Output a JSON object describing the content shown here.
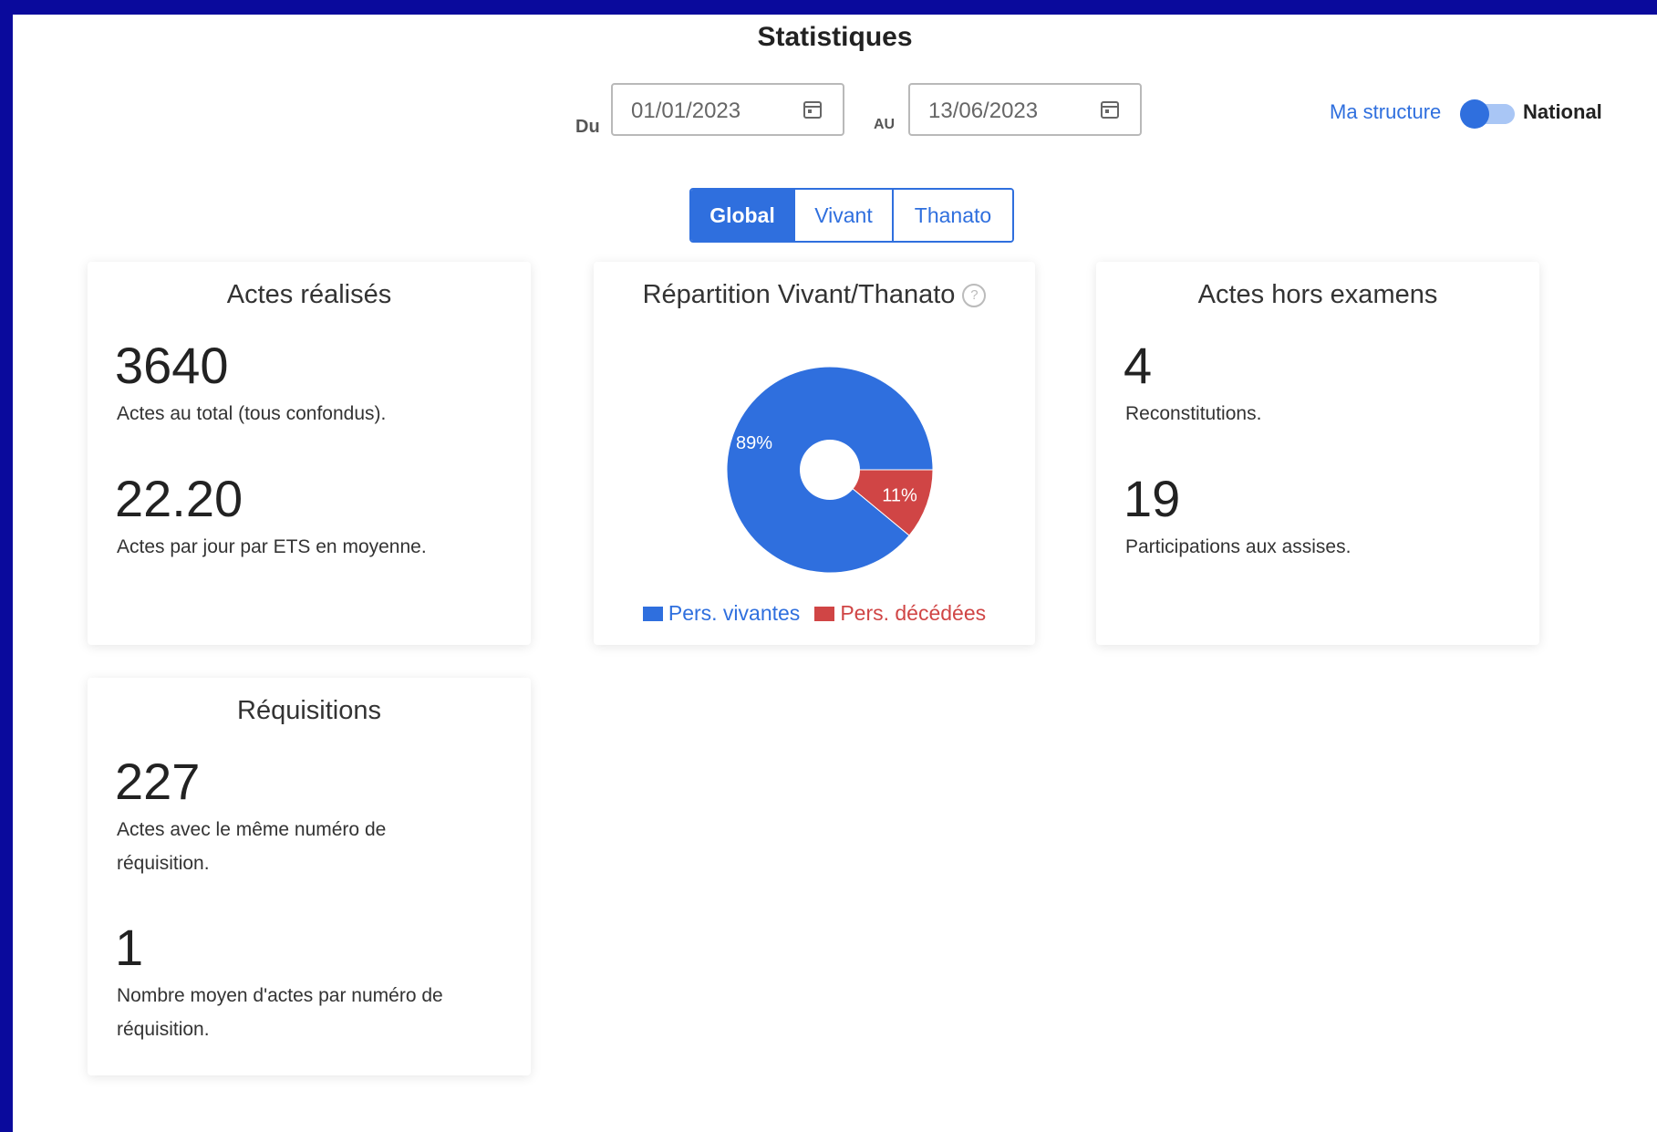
{
  "page_title": "Statistiques",
  "filters": {
    "from_label": "Du",
    "from_value": "01/01/2023",
    "to_label": "AU",
    "to_value": "13/06/2023",
    "scope_left": "Ma structure",
    "scope_right": "National",
    "scope_selected": "Ma structure"
  },
  "tabs": [
    {
      "label": "Global",
      "active": true
    },
    {
      "label": "Vivant",
      "active": false
    },
    {
      "label": "Thanato",
      "active": false
    }
  ],
  "cards": {
    "actes": {
      "title": "Actes réalisés",
      "stat1_value": "3640",
      "stat1_desc": "Actes au total (tous confondus).",
      "stat2_value": "22.20",
      "stat2_desc": "Actes par jour par ETS en moyenne."
    },
    "repartition": {
      "title": "Répartition Vivant/Thanato",
      "help_icon": "question-circle-icon"
    },
    "hors_examens": {
      "title": "Actes hors examens",
      "stat1_value": "4",
      "stat1_desc": "Reconstitutions.",
      "stat2_value": "19",
      "stat2_desc": "Participations aux assises."
    },
    "requisitions": {
      "title": "Réquisitions",
      "stat1_value": "227",
      "stat1_desc": "Actes avec le même numéro de réquisition.",
      "stat2_value": "1",
      "stat2_desc": "Nombre moyen d'actes par numéro de réquisition."
    }
  },
  "chart_data": {
    "type": "pie",
    "categories": [
      "Pers. vivantes",
      "Pers. décédées"
    ],
    "values": [
      89,
      11
    ],
    "labels": [
      "89%",
      "11%"
    ],
    "colors": [
      "#2f6fde",
      "#d04545"
    ],
    "donut": true,
    "legend": "bottom"
  },
  "colors": {
    "accent": "#2f6fde",
    "danger": "#d04545",
    "frame": "#0a0a9c"
  }
}
